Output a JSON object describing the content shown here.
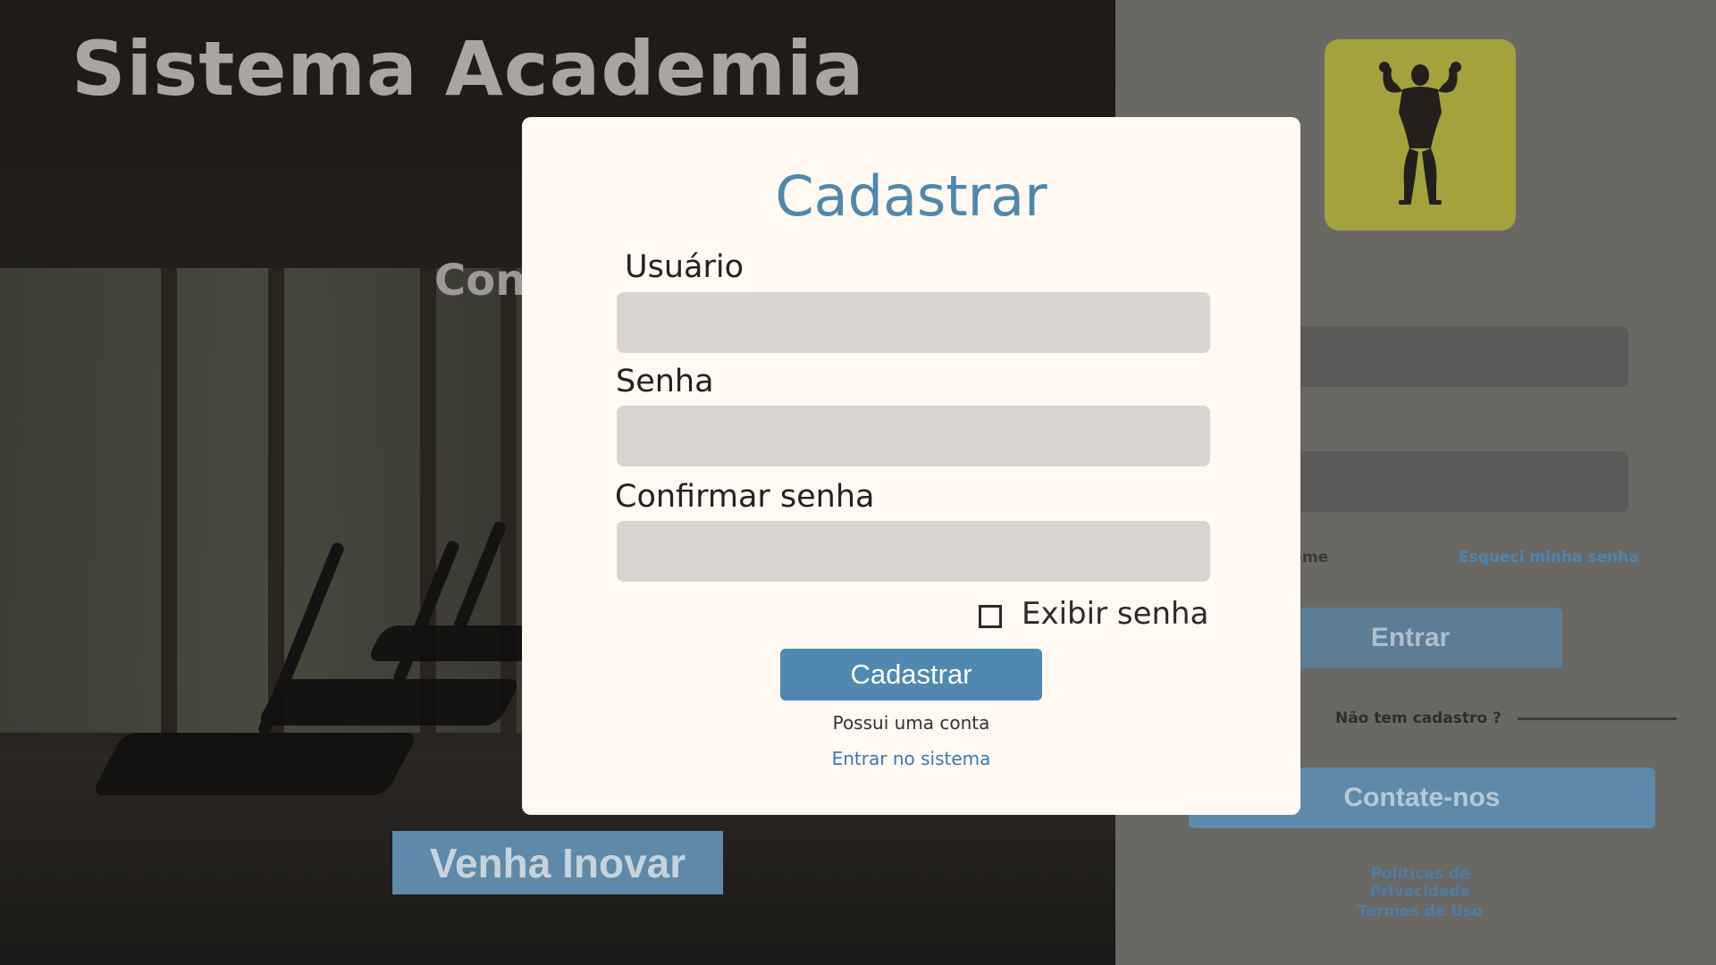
{
  "hero": {
    "title": "Sistema Academia",
    "subtitle": "Con",
    "cta_label": "Venha Inovar"
  },
  "login_panel": {
    "logo_icon": "bodybuilder-icon",
    "remember_text": "-me",
    "forgot_label": "Esqueci minha senha",
    "enter_label": "Entrar",
    "no_account_text": "Não tem cadastro ?",
    "contact_label": "Contate-nos",
    "privacy_label": "Políticas de Privacidade",
    "terms_label": "Termos de Uso"
  },
  "modal": {
    "title": "Cadastrar",
    "username_label": "Usuário",
    "username_value": "",
    "password_label": "Senha",
    "password_value": "",
    "confirm_label": "Confirmar senha",
    "confirm_value": "",
    "show_password_label": "Exibir senha",
    "show_password_checked": false,
    "submit_label": "Cadastrar",
    "has_account_text": "Possui uma conta",
    "login_link_label": "Entrar no sistema"
  },
  "colors": {
    "accent_blue": "#4f88b0",
    "logo_bg": "#a3a23d",
    "modal_bg": "#fff9f2",
    "input_bg": "#d8d4cf"
  }
}
